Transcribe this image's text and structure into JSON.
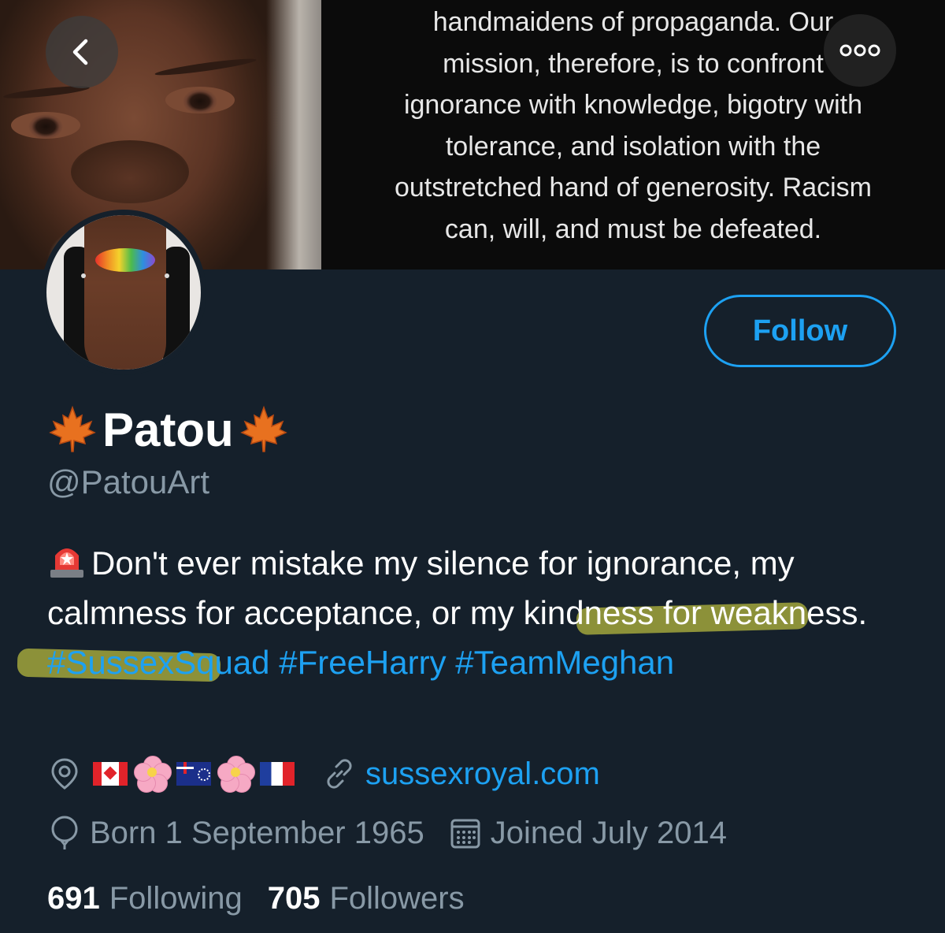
{
  "banner": {
    "quote_lines": [
      "handmaidens of propaganda. Our",
      "mission, therefore, is to confront",
      "ignorance with knowledge, bigotry with",
      "tolerance, and isolation with the",
      "outstretched hand of generosity. Racism",
      "can, will, and must be defeated."
    ]
  },
  "icons": {
    "back": "chevron-left-icon",
    "more": "more-icon",
    "location": "location-icon",
    "link": "link-icon",
    "birthday": "balloon-icon",
    "calendar": "calendar-icon",
    "name_emoji": "maple-leaf-emoji",
    "bio_emoji": "police-light-emoji"
  },
  "actions": {
    "follow_label": "Follow"
  },
  "profile": {
    "display_name": "Patou",
    "handle": "@PatouArt",
    "bio_text": "Don't ever mistake my silence for ignorance, my calmness for acceptance, or my kindness for weakness.",
    "hashtags": [
      "#SussexSquad",
      "#FreeHarry",
      "#TeamMeghan"
    ],
    "location_emoji": [
      "canada-flag",
      "cherry-blossom",
      "cook-islands-flag",
      "cherry-blossom",
      "france-flag"
    ],
    "website": "sussexroyal.com",
    "born": "Born 1 September 1965",
    "joined": "Joined July 2014"
  },
  "stats": {
    "following_count": "691",
    "following_label": "Following",
    "followers_count": "705",
    "followers_label": "Followers"
  },
  "colors": {
    "background": "#15202b",
    "accent": "#1da1f2",
    "secondary_text": "#8899a6",
    "highlighter": "#eeee46"
  }
}
